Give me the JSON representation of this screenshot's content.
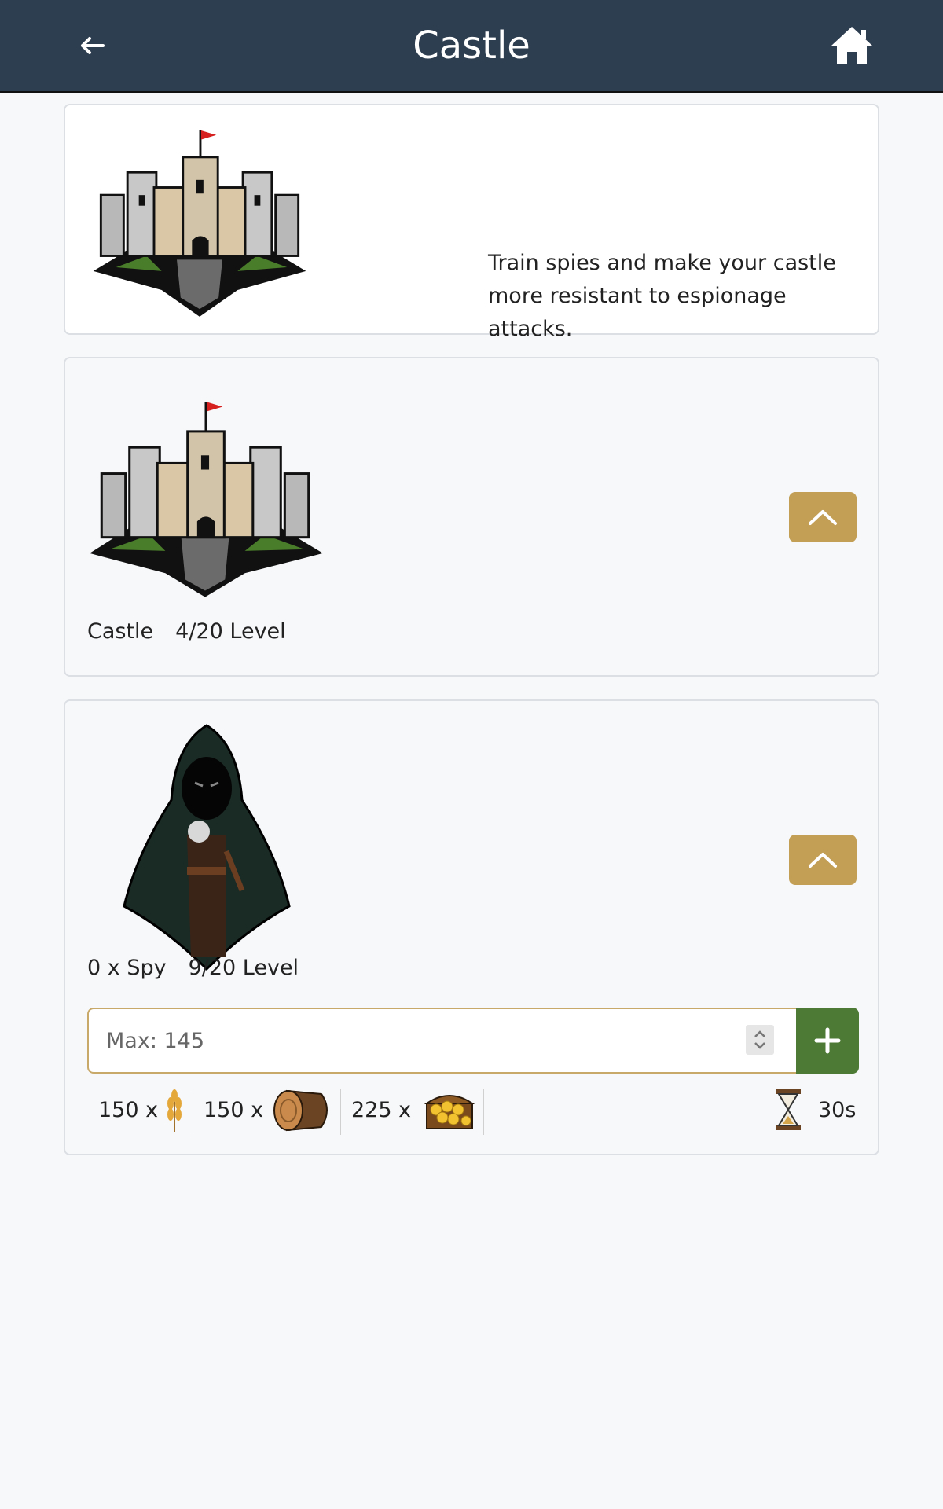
{
  "header": {
    "title": "Castle",
    "back_icon": "arrow-left-icon",
    "home_icon": "home-icon"
  },
  "intro": {
    "description": "Train spies and make your castle more resistant to espionage attacks.",
    "image": "castle-illustration"
  },
  "castle_building": {
    "name": "Castle",
    "level": "4/20 Level",
    "upgrade_icon": "chevron-up-icon"
  },
  "spy_unit": {
    "count_label": "0 x Spy",
    "level": "9/20 Level",
    "upgrade_icon": "chevron-up-icon",
    "quantity_placeholder": "Max: 145",
    "add_icon": "plus-icon",
    "costs": [
      {
        "amount": "150 x",
        "icon": "wheat-icon"
      },
      {
        "amount": "150 x",
        "icon": "wood-log-icon"
      },
      {
        "amount": "225 x",
        "icon": "gold-chest-icon"
      }
    ],
    "time": {
      "icon": "hourglass-icon",
      "value": "30s"
    }
  },
  "colors": {
    "header_bg": "#2e3e51",
    "upgrade_btn": "#c39f56",
    "add_btn": "#4d7a34",
    "input_border": "#c9a96a"
  }
}
